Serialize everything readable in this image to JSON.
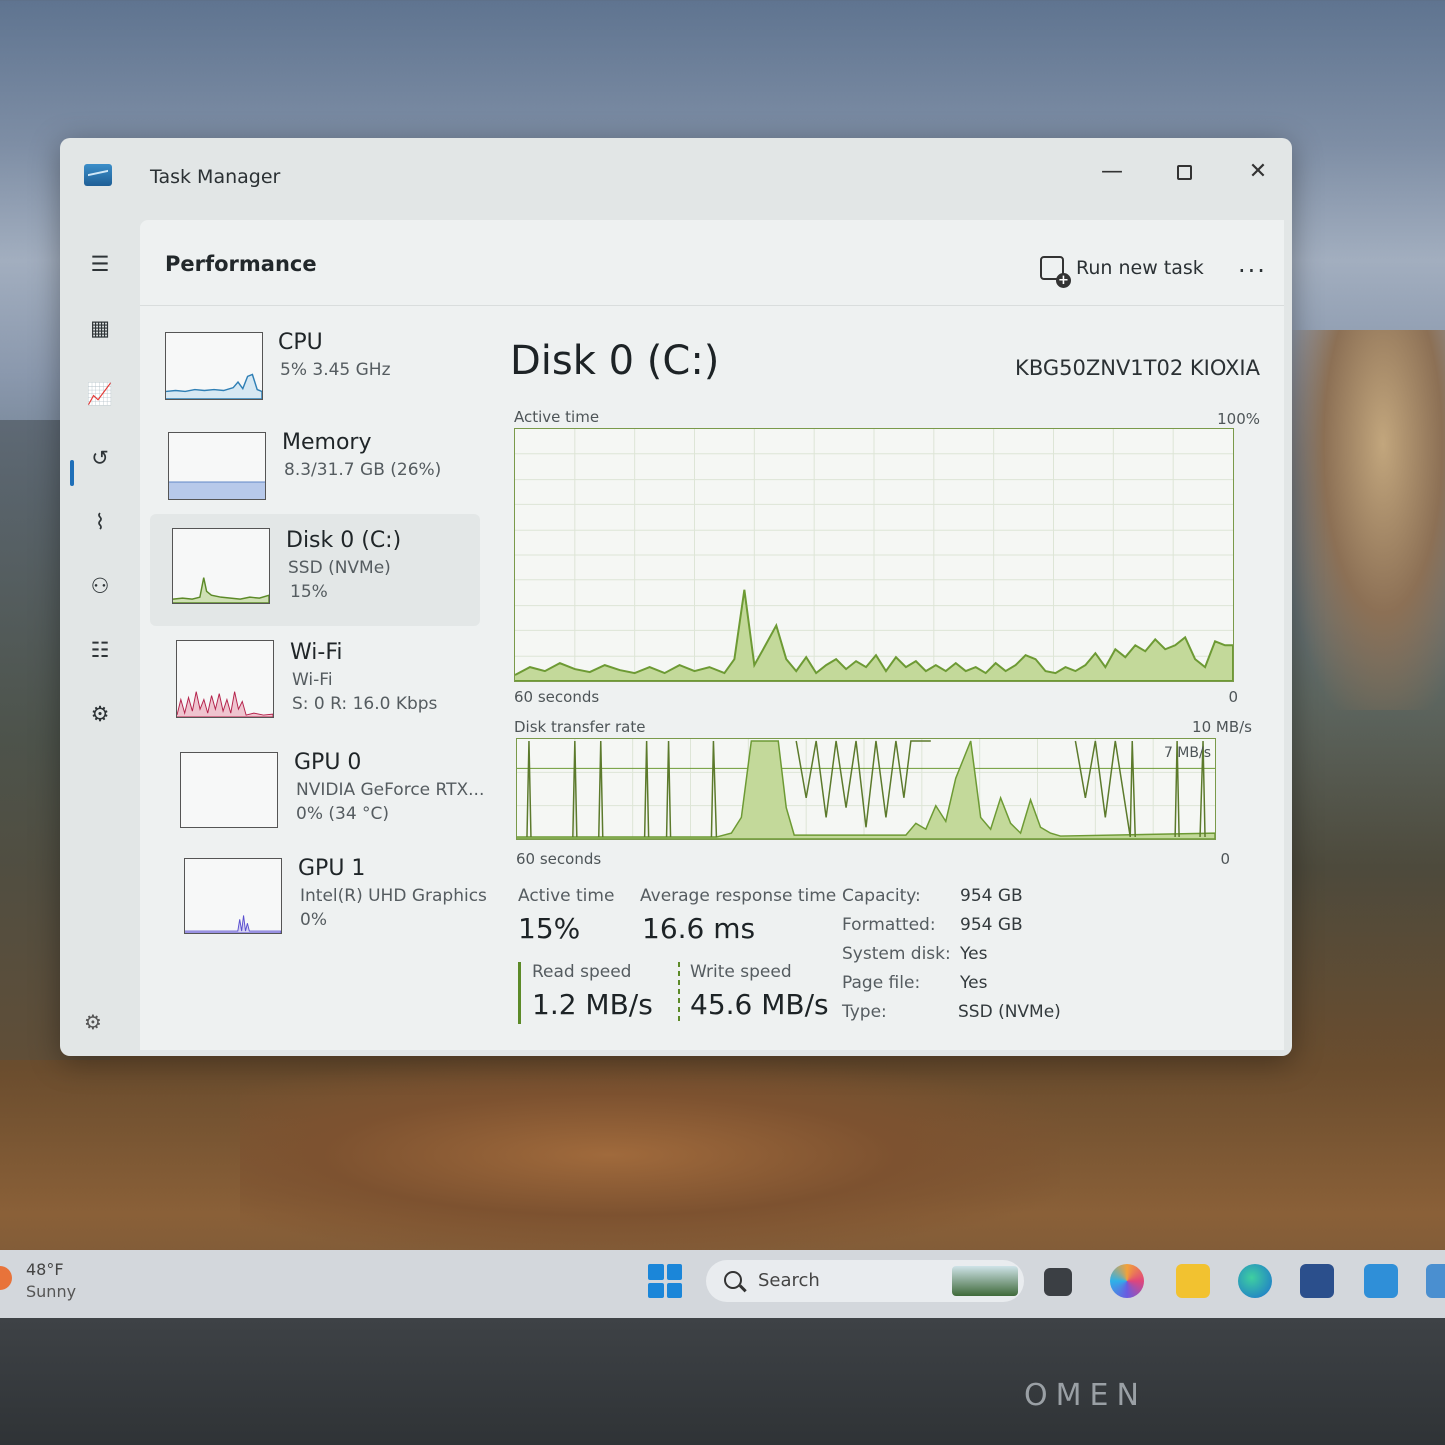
{
  "window": {
    "title": "Task Manager",
    "minimize_glyph": "—",
    "close_glyph": "✕"
  },
  "header": {
    "page_title": "Performance",
    "run_new_task": "Run new task",
    "more_glyph": "..."
  },
  "nav": {
    "items": [
      "menu-icon",
      "processes-icon",
      "performance-icon",
      "app-history-icon",
      "startup-apps-icon",
      "users-icon",
      "details-icon",
      "services-icon"
    ],
    "settings": "settings-icon"
  },
  "resources": [
    {
      "name": "CPU",
      "line1": "5%  3.45 GHz",
      "line2": "",
      "color": "#2f7fb5"
    },
    {
      "name": "Memory",
      "line1": "8.3/31.7 GB (26%)",
      "line2": "",
      "color": "#7f9ed1"
    },
    {
      "name": "Disk 0 (C:)",
      "line1": "SSD (NVMe)",
      "line2": "15%",
      "color": "#5c8a28"
    },
    {
      "name": "Wi-Fi",
      "line1": "Wi-Fi",
      "line2": "S: 0  R: 16.0 Kbps",
      "color": "#b4224b"
    },
    {
      "name": "GPU 0",
      "line1": "NVIDIA GeForce RTX...",
      "line2": "0%  (34 °C)",
      "color": "#5a4fcf"
    },
    {
      "name": "GPU 1",
      "line1": "Intel(R) UHD Graphics",
      "line2": "0%",
      "color": "#5a4fcf"
    }
  ],
  "detail": {
    "title": "Disk 0 (C:)",
    "model": "KBG50ZNV1T02 KIOXIA",
    "active_graph": {
      "label": "Active time",
      "max_label": "100%",
      "time_label": "60 seconds",
      "min_label": "0"
    },
    "transfer_graph": {
      "label": "Disk transfer rate",
      "max_label": "10 MB/s",
      "mid_label": "7 MB/s",
      "time_label": "60 seconds",
      "min_label": "0"
    },
    "stats": {
      "active_time_label": "Active time",
      "active_time_value": "15%",
      "avg_response_label": "Average response time",
      "avg_response_value": "16.6 ms",
      "read_label": "Read speed",
      "read_value": "1.2 MB/s",
      "write_label": "Write speed",
      "write_value": "45.6 MB/s"
    },
    "props": [
      {
        "label": "Capacity:",
        "value": "954 GB"
      },
      {
        "label": "Formatted:",
        "value": "954 GB"
      },
      {
        "label": "System disk:",
        "value": "Yes"
      },
      {
        "label": "Page file:",
        "value": "Yes"
      },
      {
        "label": "Type:",
        "value": "SSD (NVMe)"
      }
    ]
  },
  "taskbar": {
    "temp": "48°F",
    "condition": "Sunny",
    "search_placeholder": "Search"
  },
  "device_brand": "OMEN"
}
